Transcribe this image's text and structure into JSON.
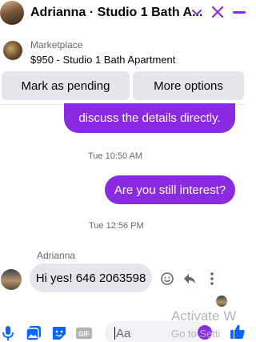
{
  "header": {
    "title": "Adrianna · Studio 1 Bath A...",
    "icons": [
      "chevron-down-icon",
      "close-icon",
      "minimize-icon"
    ],
    "accent_color": "#8a2be2"
  },
  "listing": {
    "label": "Marketplace",
    "price_title": "$950 - Studio 1 Bath Apartment"
  },
  "actions": {
    "pending_label": "Mark as pending",
    "more_label": "More options"
  },
  "messages": {
    "out1": "discuss the details directly.",
    "timestamp1": "Tue 10:50 AM",
    "out2": "Are you still interest?",
    "timestamp2": "Tue 12:56 PM",
    "sender": "Adrianna",
    "in1": "Hi yes! 646 2063598"
  },
  "composer": {
    "placeholder": "Aa",
    "icons": [
      "microphone-icon",
      "photo-icon",
      "sticker-icon",
      "gif-icon",
      "emoji-icon",
      "thumbs-up-icon"
    ]
  },
  "watermark": {
    "line1": "Activate W",
    "line2": "Go to Setti"
  }
}
